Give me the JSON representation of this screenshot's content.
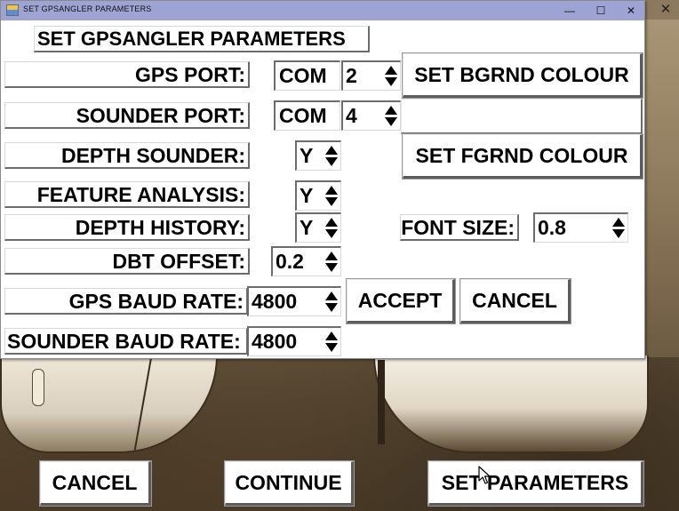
{
  "window": {
    "title": "SET GPSANGLER PARAMETERS",
    "minimize": "—",
    "maximize": "☐",
    "close": "✕",
    "outer_close": "✕"
  },
  "form": {
    "heading": "SET GPSANGLER PARAMETERS",
    "gps_port": {
      "label": "GPS PORT:",
      "type": "COM",
      "number": "2"
    },
    "sounder_port": {
      "label": "SOUNDER PORT:",
      "type": "COM",
      "number": "4"
    },
    "depth_sounder": {
      "label": "DEPTH SOUNDER:",
      "value": "Y"
    },
    "feature_analysis": {
      "label": "FEATURE ANALYSIS:",
      "value": "Y"
    },
    "depth_history": {
      "label": "DEPTH HISTORY:",
      "value": "Y"
    },
    "dbt_offset": {
      "label": "DBT OFFSET:",
      "value": "0.2"
    },
    "gps_baud": {
      "label": "GPS BAUD RATE:",
      "value": "4800"
    },
    "sounder_baud": {
      "label": "SOUNDER BAUD RATE:",
      "value": "4800"
    },
    "font_size": {
      "label": "FONT SIZE:",
      "value": "0.8"
    },
    "set_bgrnd_label": "SET BGRND COLOUR",
    "set_fgrnd_label": "SET FGRND COLOUR",
    "accept_label": "ACCEPT",
    "cancel_label": "CANCEL"
  },
  "main": {
    "cancel_label": "CANCEL",
    "continue_label": "CONTINUE",
    "set_parameters_label": "SET PARAMETERS"
  },
  "icons": {
    "app": "app-icon",
    "spinner": "up-down-arrows-icon",
    "cursor": "mouse-pointer-icon"
  }
}
